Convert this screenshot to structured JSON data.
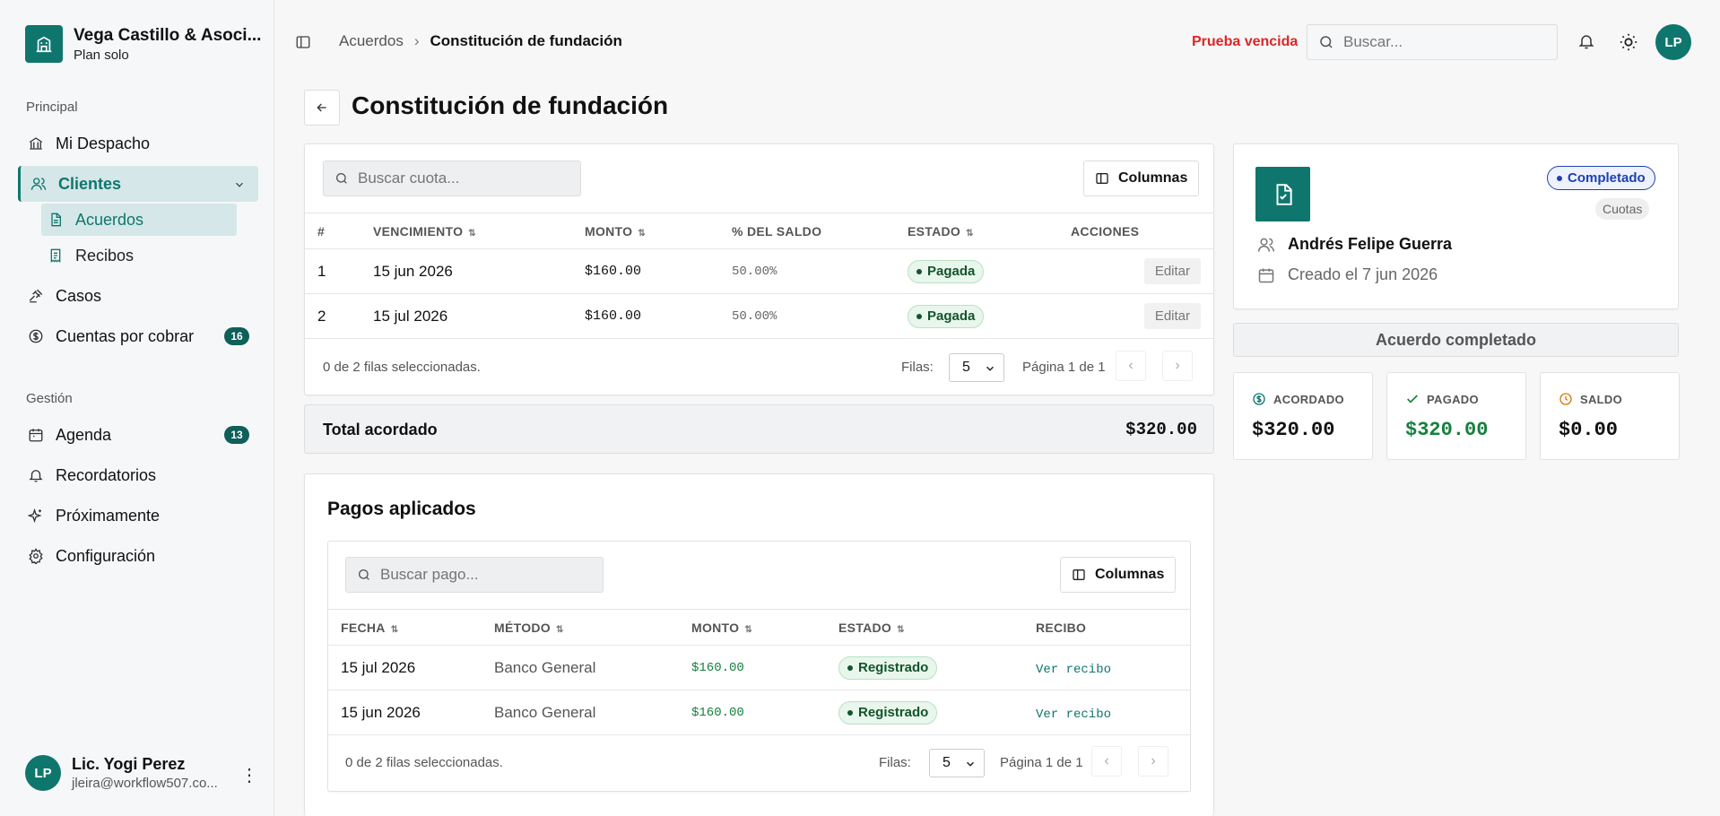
{
  "sidebar": {
    "brand_name": "Vega Castillo & Asoci...",
    "plan": "Plan solo",
    "section_principal": "Principal",
    "section_gestion": "Gestión",
    "items": {
      "mi_despacho": "Mi Despacho",
      "clientes": "Clientes",
      "acuerdos": "Acuerdos",
      "recibos": "Recibos",
      "casos": "Casos",
      "cuentas": "Cuentas por cobrar",
      "cuentas_badge": "16",
      "agenda": "Agenda",
      "agenda_badge": "13",
      "recordatorios": "Recordatorios",
      "proximamente": "Próximamente",
      "configuracion": "Configuración"
    },
    "user": {
      "initials": "LP",
      "name": "Lic. Yogi Perez",
      "email": "jleira@workflow507.co..."
    }
  },
  "header": {
    "breadcrumb_parent": "Acuerdos",
    "breadcrumb_current": "Constitución de fundación",
    "trial_status": "Prueba vencida",
    "search_placeholder": "Buscar...",
    "avatar_initials": "LP"
  },
  "page": {
    "title": "Constitución de fundación"
  },
  "installments": {
    "search_placeholder": "Buscar cuota...",
    "columns_label": "Columnas",
    "headers": [
      "#",
      "VENCIMIENTO",
      "MONTO",
      "% DEL SALDO",
      "ESTADO",
      "ACCIONES"
    ],
    "rows": [
      {
        "n": "1",
        "due": "15 jun 2026",
        "amount": "$160.00",
        "pct": "50.00%",
        "status": "Pagada",
        "action": "Editar"
      },
      {
        "n": "2",
        "due": "15 jul 2026",
        "amount": "$160.00",
        "pct": "50.00%",
        "status": "Pagada",
        "action": "Editar"
      }
    ],
    "selection_text": "0 de 2 filas seleccionadas.",
    "rows_label": "Filas:",
    "rows_value": "5",
    "page_text": "Página 1 de 1",
    "total_label": "Total acordado",
    "total_value": "$320.00"
  },
  "payments": {
    "title": "Pagos aplicados",
    "search_placeholder": "Buscar pago...",
    "columns_label": "Columnas",
    "headers": [
      "FECHA",
      "MÉTODO",
      "MONTO",
      "ESTADO",
      "RECIBO"
    ],
    "rows": [
      {
        "date": "15 jul 2026",
        "method": "Banco General",
        "amount": "$160.00",
        "status": "Registrado",
        "receipt": "Ver recibo"
      },
      {
        "date": "15 jun 2026",
        "method": "Banco General",
        "amount": "$160.00",
        "status": "Registrado",
        "receipt": "Ver recibo"
      }
    ],
    "selection_text": "0 de 2 filas seleccionadas.",
    "rows_label": "Filas:",
    "rows_value": "5",
    "page_text": "Página 1 de 1"
  },
  "summary": {
    "status": "Completado",
    "type": "Cuotas",
    "client": "Andrés Felipe Guerra",
    "created": "Creado el 7 jun 2026",
    "completed_banner": "Acuerdo completado",
    "acordado_label": "ACORDADO",
    "acordado_value": "$320.00",
    "pagado_label": "PAGADO",
    "pagado_value": "$320.00",
    "saldo_label": "SALDO",
    "saldo_value": "$0.00",
    "colors": {
      "brand": "#0f766e",
      "paid": "#15803d",
      "saldo_icon": "#d97706",
      "blue": "#1e40af"
    }
  }
}
